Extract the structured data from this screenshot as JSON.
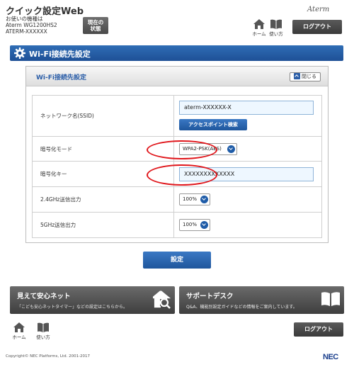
{
  "header": {
    "app_title": "クイック設定Web",
    "device_info": [
      "お使いの機種は",
      "Aterm WG1200HS2",
      "ATERM-XXXXXX"
    ],
    "status_button": [
      "現在の",
      "状態"
    ],
    "brand": "Aterm",
    "home_label": "ホーム",
    "manual_label": "使い方",
    "logout_label": "ログアウト"
  },
  "page": {
    "title": "Wi-Fi接続先設定"
  },
  "panel": {
    "title": "Wi-Fi接続先設定",
    "close_label": "閉じる",
    "ssid_label": "ネットワーク名(SSID)",
    "ssid_value": "aterm-XXXXXX-X",
    "ap_search_label": "アクセスポイント検索",
    "enc_mode_label": "暗号化モード",
    "enc_mode_value": "WPA2-PSK(AES)",
    "enc_key_label": "暗号化キー",
    "enc_key_value": "XXXXXXXXXXXXX",
    "power24_label": "2.4GHz送信出力",
    "power24_value": "100%",
    "power5_label": "5GHz送信出力",
    "power5_value": "100%"
  },
  "submit_label": "設定",
  "cards": [
    {
      "title": "見えて安心ネット",
      "desc": "「こども安心ネットタイマー」などの設定はこちらから。",
      "icon": "house-magnifier-icon"
    },
    {
      "title": "サポートデスク",
      "desc": "Q&A、機能別設定ガイドなどの情報をご案内しています。",
      "icon": "book-icon"
    }
  ],
  "footer": {
    "home_label": "ホーム",
    "manual_label": "使い方",
    "logout_label": "ログアウト",
    "copyright": "Copyright© NEC Platforms, Ltd. 2001-2017",
    "company_logo": "NEC"
  },
  "colors": {
    "primary_blue": "#1e5096",
    "highlight_red": "#e0161b",
    "dark_button": "#3e3e3e"
  }
}
